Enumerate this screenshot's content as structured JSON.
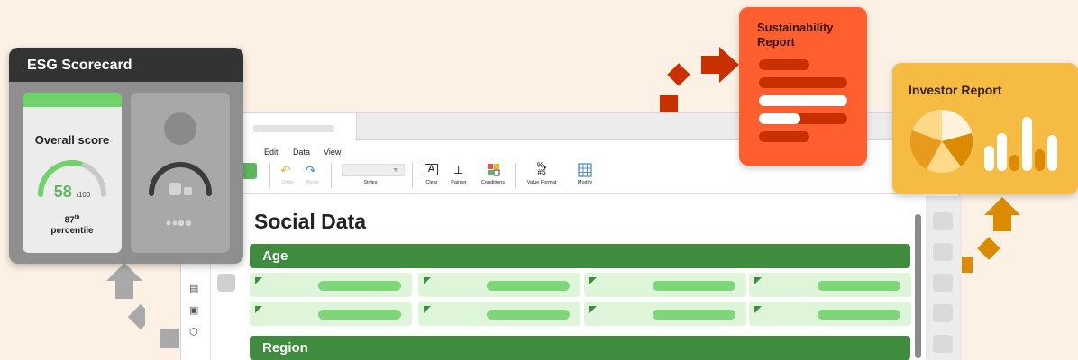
{
  "esg_card": {
    "title": "ESG Scorecard",
    "overall_label": "Overall score",
    "score": "58",
    "score_max": "/100",
    "percentile_num": "87",
    "percentile_sup": "th",
    "percentile_word": "percentile",
    "score_fraction": 0.58
  },
  "menu": {
    "edit": "Edit",
    "data": "Data",
    "view": "View"
  },
  "toolbar": {
    "undo": "Undo",
    "redo": "Redo",
    "styles": "Styles",
    "clear": "Clear",
    "painter": "Painter",
    "conditions": "Conditions",
    "value_format": "Value Format",
    "modify": "Modify"
  },
  "sheet": {
    "title": "Social Data",
    "sections": [
      "Age",
      "Region"
    ]
  },
  "reports": {
    "sustainability": "Sustainability Report",
    "investor": "Investor Report"
  },
  "colors": {
    "background": "#fcf1e4",
    "section_green": "#3f8c3f",
    "cell_green": "#dff5d9",
    "sustainability_orange": "#ff5e2f",
    "investor_yellow": "#f5bb43",
    "score_green": "#5bb95b"
  },
  "icons": [
    "undo-icon",
    "redo-icon",
    "clear-icon",
    "painter-icon",
    "conditions-icon",
    "value-format-icon",
    "modify-icon",
    "pie-chart-icon",
    "bar-chart-icon",
    "arrow-up-icon",
    "arrow-right-icon",
    "avatar-icon"
  ]
}
